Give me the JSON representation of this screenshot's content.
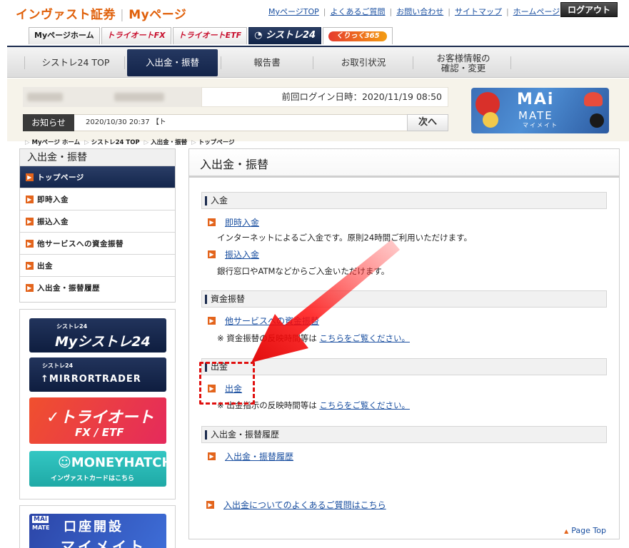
{
  "header": {
    "brand": "インヴァスト証券",
    "mypage": "Myページ",
    "links": [
      "MyページTOP",
      "よくあるご質問",
      "お問い合わせ",
      "サイトマップ",
      "ホームページ"
    ],
    "logout_label": "ログアウト"
  },
  "product_tabs": {
    "home": "Myページホーム",
    "fx": "トライオートFX",
    "etf": "トライオートETF",
    "systre": "シストレ24",
    "kurikku": "くりっく365"
  },
  "main_nav": {
    "items": [
      "シストレ24 TOP",
      "入出金・振替",
      "報告書",
      "お取引状況"
    ],
    "customer_line1": "お客様情報の",
    "customer_line2": "確認・変更"
  },
  "info": {
    "last_login": "前回ログイン日時：2020/11/19 08:50",
    "notice_label": "お知らせ",
    "notice_text": "2020/10/30  20:37 【ト",
    "next_label": "次へ"
  },
  "mai_banner": {
    "title": "MAi",
    "sub": "MATE",
    "kana": "マイメイト"
  },
  "breadcrumb": [
    "Myページ ホーム",
    "シストレ24 TOP",
    "入出金・振替",
    "トップページ"
  ],
  "sidebar": {
    "title": "入出金・振替",
    "items": [
      "トップページ",
      "即時入金",
      "振込入金",
      "他サービスへの資金振替",
      "出金",
      "入出金・振替履歴"
    ]
  },
  "banners": {
    "mysystre_small": "シストレ24",
    "mysystre_big": "Myシストレ24",
    "mirror_small": "シストレ24",
    "mirror_big": "MIRRORTRADER",
    "triauto_big": "トライオート",
    "triauto_sub": "FX / ETF",
    "moneyhatch_big": "MONEYHATCH",
    "moneyhatch_sub": "インヴァストカードはこちら",
    "koza_tag1": "MAi",
    "koza_tag2": "MATE",
    "koza_big": "口座開設",
    "koza_sub": "マイメイト"
  },
  "content": {
    "title": "入出金・振替",
    "sections": [
      {
        "heading": "入金"
      },
      {
        "heading": "資金振替"
      },
      {
        "heading": "出金"
      },
      {
        "heading": "入出金・振替履歴"
      }
    ],
    "instant_deposit": "即時入金",
    "instant_desc": "インターネットによるご入金です。原則24時間ご利用いただけます。",
    "transfer_deposit": "振込入金",
    "transfer_desc": "銀行窓口やATMなどからご入金いただけます。",
    "other_transfer": "他サービスへの資金振替",
    "transfer_note": "※ 資金振替の反映時間等は",
    "transfer_note_link": "こちらをご覧ください。",
    "withdraw": "出金",
    "withdraw_note": "※ 出金指示の反映時間等は",
    "withdraw_note_link": "こちらをご覧ください。",
    "history": "入出金・振替履歴",
    "faq": "入出金についてのよくあるご質問はこちら",
    "page_top": "Page Top"
  },
  "colors": {
    "accent": "#e0600a",
    "navy": "#1b2b4e",
    "link": "#1a4fa0",
    "annotation": "#e0100f"
  }
}
